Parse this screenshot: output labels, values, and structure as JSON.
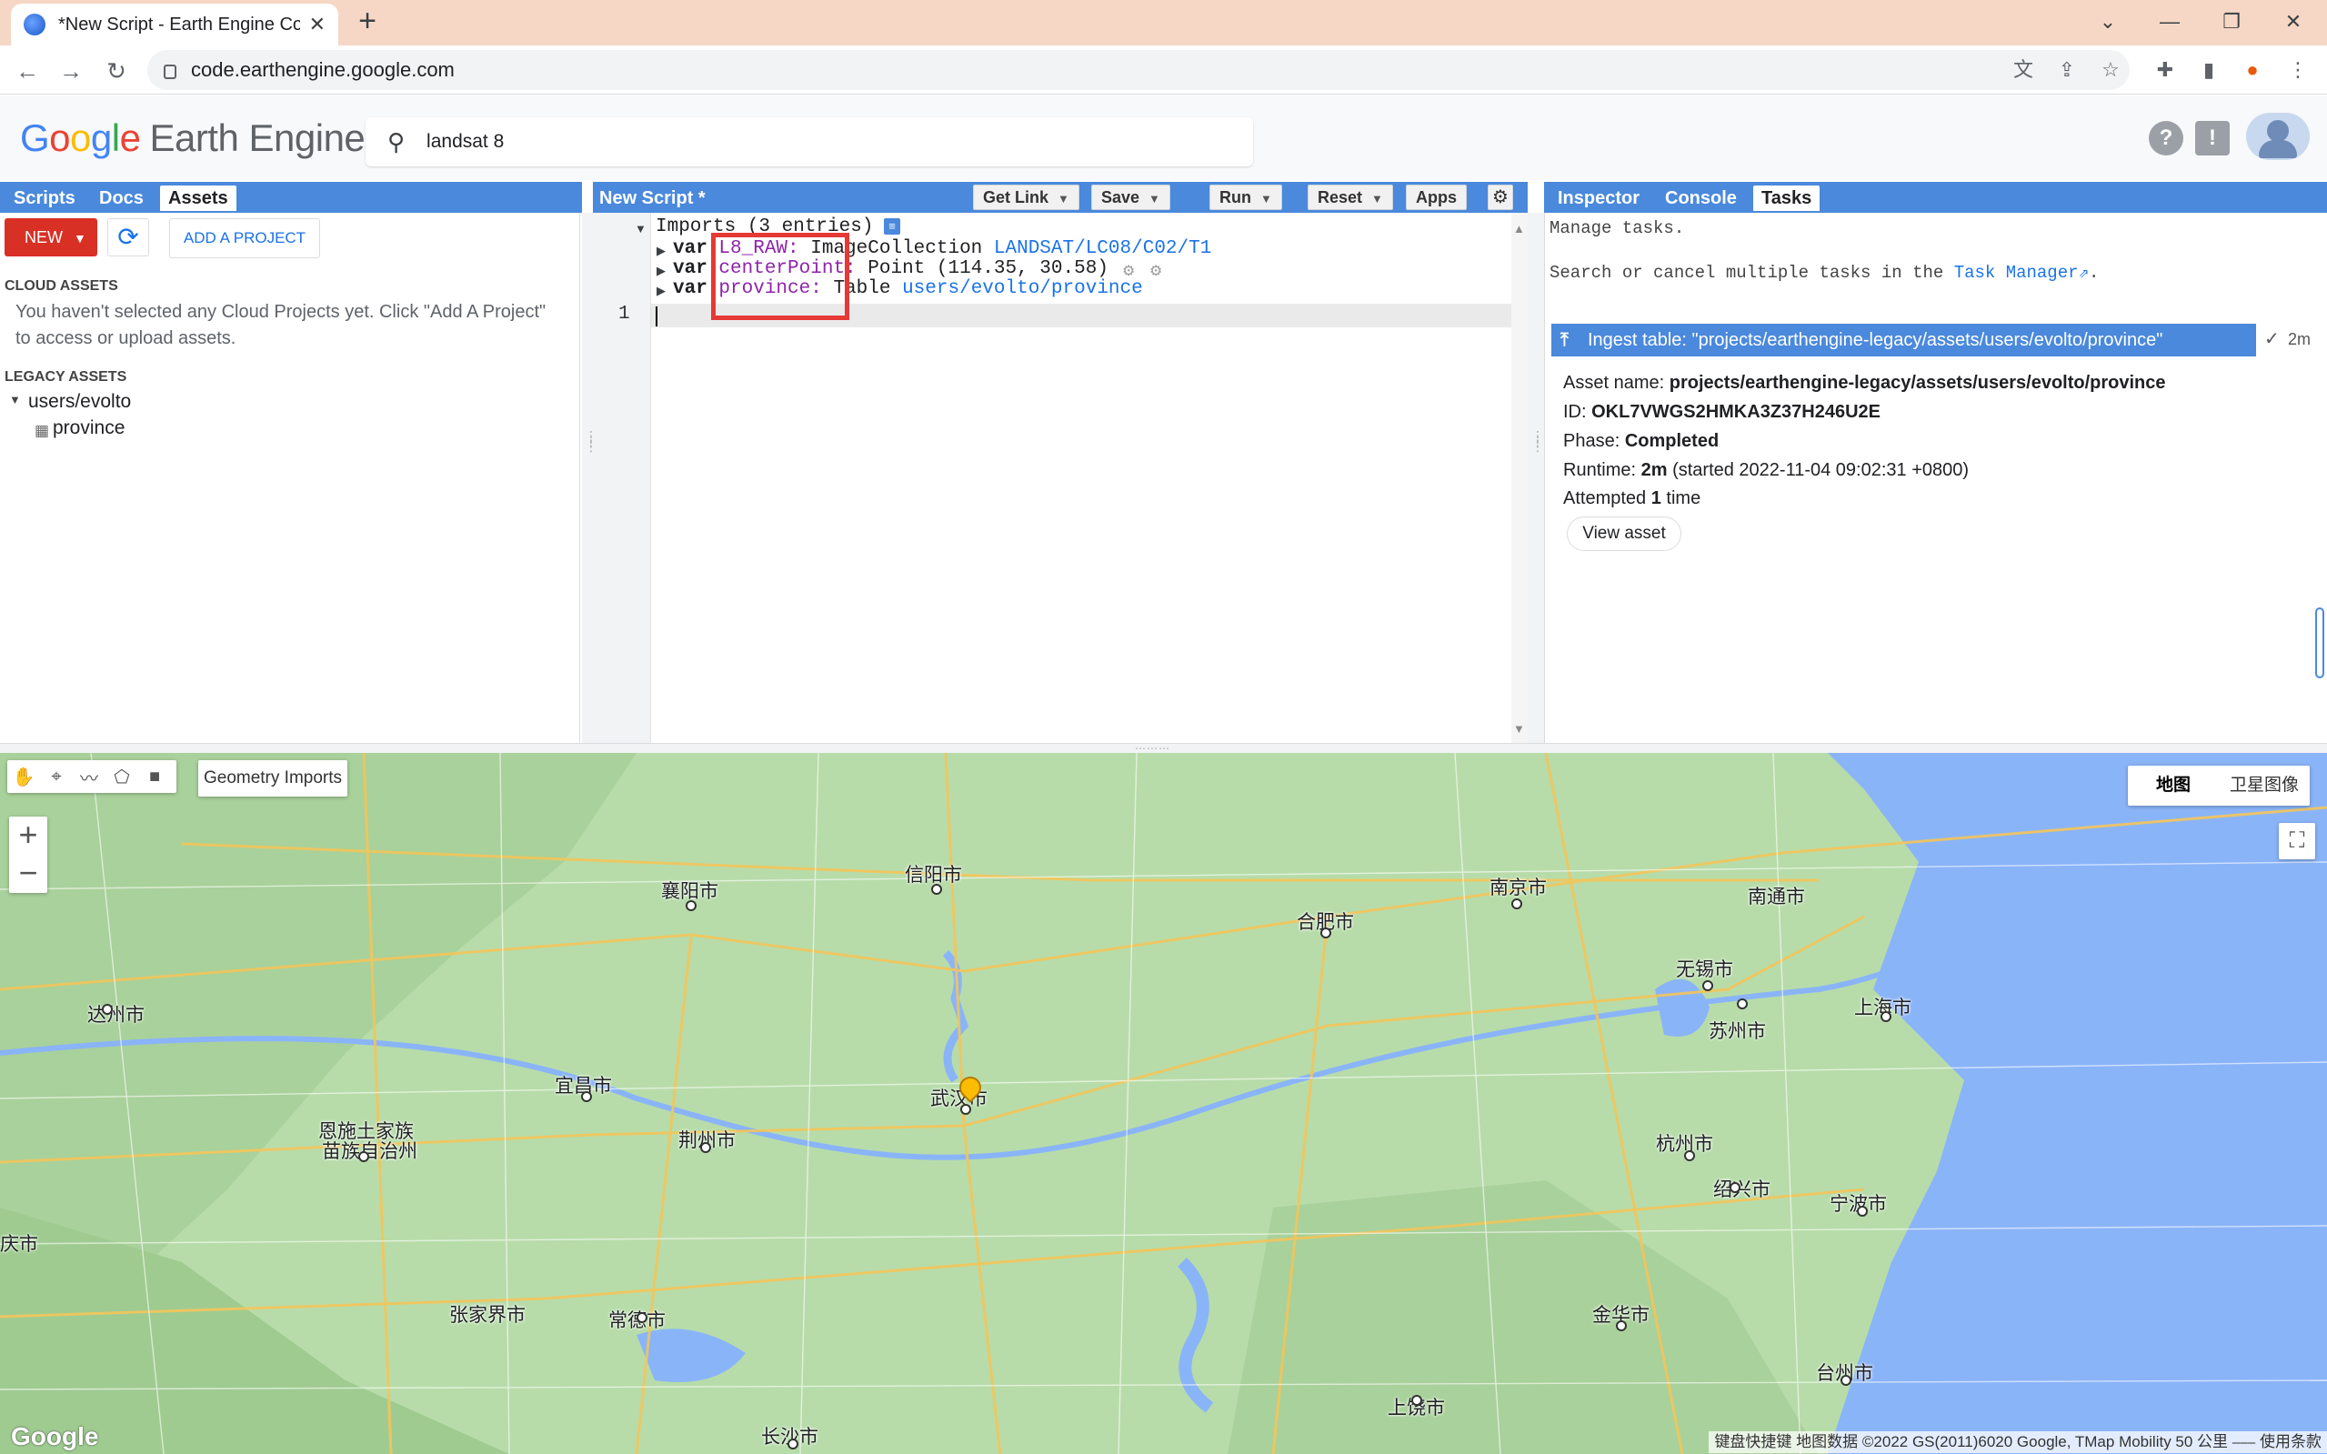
{
  "browser": {
    "tab_title": "*New Script - Earth Engine Co",
    "url": "code.earthengine.google.com"
  },
  "header": {
    "logo_google": [
      "G",
      "o",
      "o",
      "g",
      "l",
      "e"
    ],
    "logo_product": "Earth Engine",
    "search_value": "landsat 8"
  },
  "left_panel": {
    "tabs": [
      "Scripts",
      "Docs",
      "Assets"
    ],
    "new_label": "NEW",
    "add_project_label": "ADD A PROJECT",
    "cloud_assets_heading": "CLOUD ASSETS",
    "cloud_assets_line1": "You haven't selected any Cloud Projects yet. Click \"Add A Project\"",
    "cloud_assets_line2": "to access or upload assets.",
    "legacy_heading": "LEGACY ASSETS",
    "legacy_folder": "users/evolto",
    "legacy_item": "province"
  },
  "editor": {
    "title": "New Script *",
    "buttons": [
      "Get Link",
      "Save",
      "Run",
      "Reset",
      "Apps"
    ],
    "imports_header": "Imports (3 entries)",
    "imports": [
      {
        "kw": "var",
        "name": "L8_RAW:",
        "type": "ImageCollection",
        "value": "LANDSAT/LC08/C02/T1"
      },
      {
        "kw": "var",
        "name": "centerPoint:",
        "type": "Point",
        "value": "(114.35, 30.58)"
      },
      {
        "kw": "var",
        "name": "province:",
        "type": "Table",
        "value": "users/evolto/province"
      }
    ],
    "line_number": "1"
  },
  "right_panel": {
    "tabs": [
      "Inspector",
      "Console",
      "Tasks"
    ],
    "manage": "Manage tasks.",
    "search_prefix": "Search or cancel multiple tasks in the",
    "task_manager_link": "Task Manager",
    "search_suffix": ".",
    "task_title": "Ingest table: \"projects/earthengine-legacy/assets/users/evolto/province\"",
    "task_duration": "2m",
    "asset_name_label": "Asset name:",
    "asset_name": "projects/earthengine-legacy/assets/users/evolto/province",
    "id_label": "ID:",
    "id": "OKL7VWGS2HMKA3Z37H246U2E",
    "phase_label": "Phase:",
    "phase": "Completed",
    "runtime_label": "Runtime:",
    "runtime": "2m",
    "runtime_started": "(started 2022-11-04 09:02:31 +0800)",
    "attempted_prefix": "Attempted",
    "attempted_count": "1",
    "attempted_suffix": "time",
    "view_asset_label": "View asset"
  },
  "map": {
    "geometry_imports_label": "Geometry Imports",
    "map_type_options": [
      "地图",
      "卫星图像"
    ],
    "map_type_selected": "地图",
    "watermark": "Google",
    "attribution": "键盘快捷键   地图数据 ©2022 GS(2011)6020 Google, TMap Mobility   50 公里 ⎯⎯⎯   使用条款",
    "cities": [
      {
        "name": "信阳市"
      },
      {
        "name": "襄阳市"
      },
      {
        "name": "南京市"
      },
      {
        "name": "南通市"
      },
      {
        "name": "合肥市"
      },
      {
        "name": "无锡市"
      },
      {
        "name": "达州市"
      },
      {
        "name": "苏州市"
      },
      {
        "name": "上海市"
      },
      {
        "name": "宜昌市"
      },
      {
        "name": "武汉市"
      },
      {
        "name": "恩施土家族"
      },
      {
        "name": "苗族自治州"
      },
      {
        "name": "荆州市"
      },
      {
        "name": "杭州市"
      },
      {
        "name": "绍兴市"
      },
      {
        "name": "宁波市"
      },
      {
        "name": "张家界市"
      },
      {
        "name": "常德市"
      },
      {
        "name": "金华市"
      },
      {
        "name": "台州市"
      },
      {
        "name": "上饶市"
      },
      {
        "name": "长沙市"
      },
      {
        "name": "庆市"
      }
    ]
  },
  "colors": {
    "gee_blue": "#4a89dc",
    "new_button": "#d93025",
    "highlight_box": "#e53935",
    "tab_strip": "#f6d7c6"
  }
}
